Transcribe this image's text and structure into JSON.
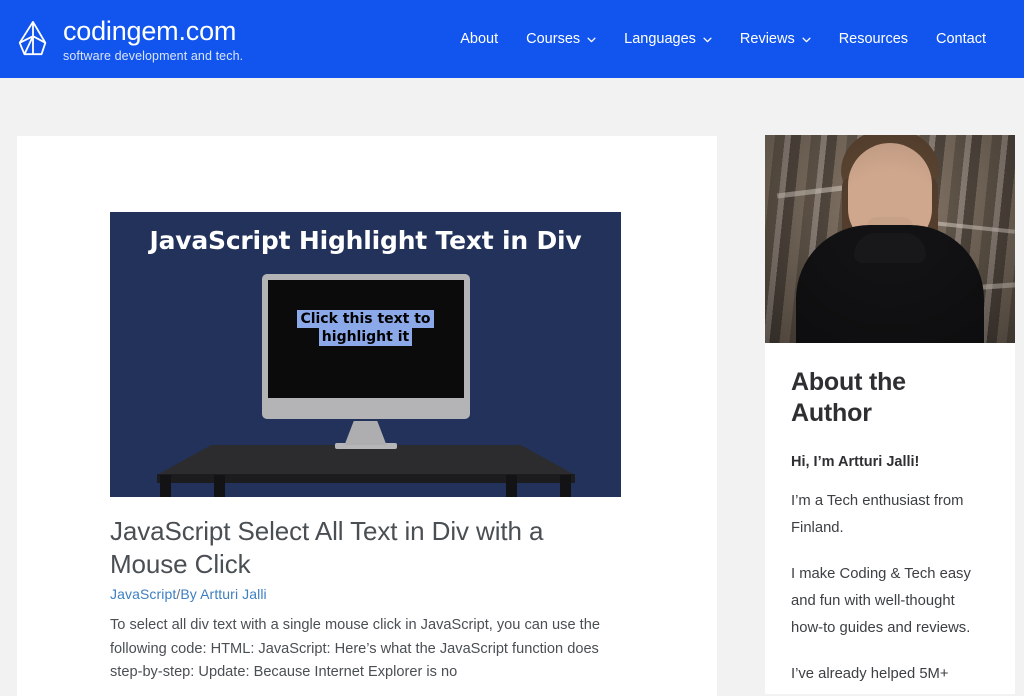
{
  "header": {
    "logo_icon": "gem-icon",
    "brand_title": "codingem.com",
    "brand_tagline": "software development and tech.",
    "brand_color": "#1155ee",
    "nav": [
      {
        "label": "About",
        "has_dropdown": false
      },
      {
        "label": "Courses",
        "has_dropdown": true
      },
      {
        "label": "Languages",
        "has_dropdown": true
      },
      {
        "label": "Reviews",
        "has_dropdown": true
      },
      {
        "label": "Resources",
        "has_dropdown": false
      },
      {
        "label": "Contact",
        "has_dropdown": false
      }
    ]
  },
  "article": {
    "featured_image": {
      "heading": "JavaScript Highlight Text in Div",
      "screen_text": "Click this text to highlight it",
      "background_color": "#23325a",
      "highlight_color": "#8ba8e8"
    },
    "title": "JavaScript Select All Text in Div with a Mouse Click",
    "category": "JavaScript",
    "byline_separator": "/",
    "byline_author": "By Artturi Jalli",
    "excerpt": "To select all div text with a single mouse click in JavaScript, you can use the following code: HTML: JavaScript: Here’s what the JavaScript function does step-by-step: Update: Because Internet Explorer is no"
  },
  "sidebar": {
    "photo_alt": "author-portrait",
    "heading": "About the Author",
    "lead": "Hi, I’m Artturi Jalli!",
    "paragraphs": [
      "I’m a Tech enthusiast from Finland.",
      "I make Coding & Tech easy and fun with well-thought how-to guides and reviews.",
      "I’ve already helped 5M+"
    ]
  }
}
